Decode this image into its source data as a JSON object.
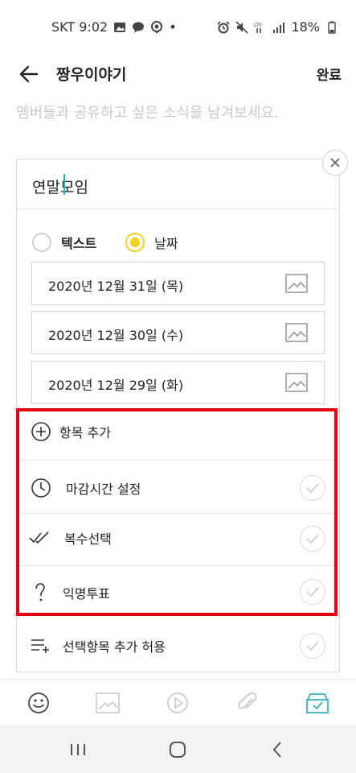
{
  "status_bar": {
    "carrier_time": "SKT 9:02",
    "dot": "•",
    "battery": "18%"
  },
  "header": {
    "title": "짱우이야기",
    "done_label": "완료"
  },
  "hint": "멤버들과 공유하고 싶은 소식을 남겨보세요.",
  "vote": {
    "title": "연말모임",
    "type_options": [
      {
        "label": "텍스트",
        "selected": false
      },
      {
        "label": "날짜",
        "selected": true
      }
    ],
    "items": [
      {
        "text": "2020년 12월 31일 (목)",
        "icon": "image-icon"
      },
      {
        "text": "2020년 12월 30일 (수)",
        "icon": "image-icon"
      },
      {
        "text": "2020년 12월 29일 (화)",
        "icon": "image-icon"
      }
    ]
  },
  "options": {
    "add_item": "항목 추가",
    "deadline": "마감시간 설정",
    "multiple": "복수선택",
    "anonymous": "익명투표",
    "allow_add": "선택항목 추가 허용"
  },
  "colors": {
    "accent_yellow": "#f2d11d",
    "highlight_red": "#e60012",
    "cursor_teal": "#2fb4a6",
    "vote_icon_teal": "#3ab0c8"
  }
}
